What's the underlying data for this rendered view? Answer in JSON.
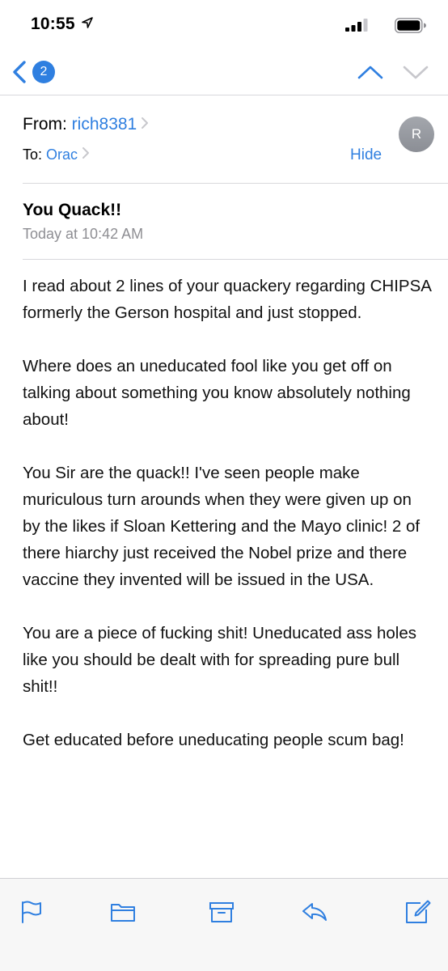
{
  "status_bar": {
    "time": "10:55",
    "location_icon": "location-arrow-icon",
    "signal_icon": "cellular-signal-icon",
    "battery_icon": "battery-icon"
  },
  "nav": {
    "back_icon": "chevron-left-icon",
    "unread_count": "2",
    "prev_icon": "chevron-up-icon",
    "next_icon": "chevron-down-icon",
    "accent_color": "#2f7fe0"
  },
  "header": {
    "from_label": "From:",
    "sender": "rich8381",
    "to_label": "To:",
    "recipient": "Orac",
    "hide_label": "Hide",
    "avatar_initial": "R"
  },
  "message": {
    "subject": "You Quack!!",
    "date": "Today at 10:42 AM",
    "paragraphs": [
      "I read about 2 lines of your quackery regarding CHIPSA formerly the Gerson hospital and just stopped.",
      "Where does an uneducated fool like you get off on talking about something you know absolutely nothing about!",
      "You Sir are the quack!! I've seen people make muriculous turn arounds when they were given up on by the likes if Sloan Kettering and the Mayo clinic! 2 of there hiarchy just received the Nobel prize and there vaccine they invented will be issued in the USA.",
      "You are a piece of fucking shit! Uneducated ass holes like you should be dealt with for spreading pure bull shit!!",
      "Get educated before uneducating people scum bag!"
    ]
  },
  "toolbar": {
    "items": [
      "flag-icon",
      "folder-icon",
      "archive-icon",
      "reply-icon",
      "compose-icon"
    ]
  }
}
